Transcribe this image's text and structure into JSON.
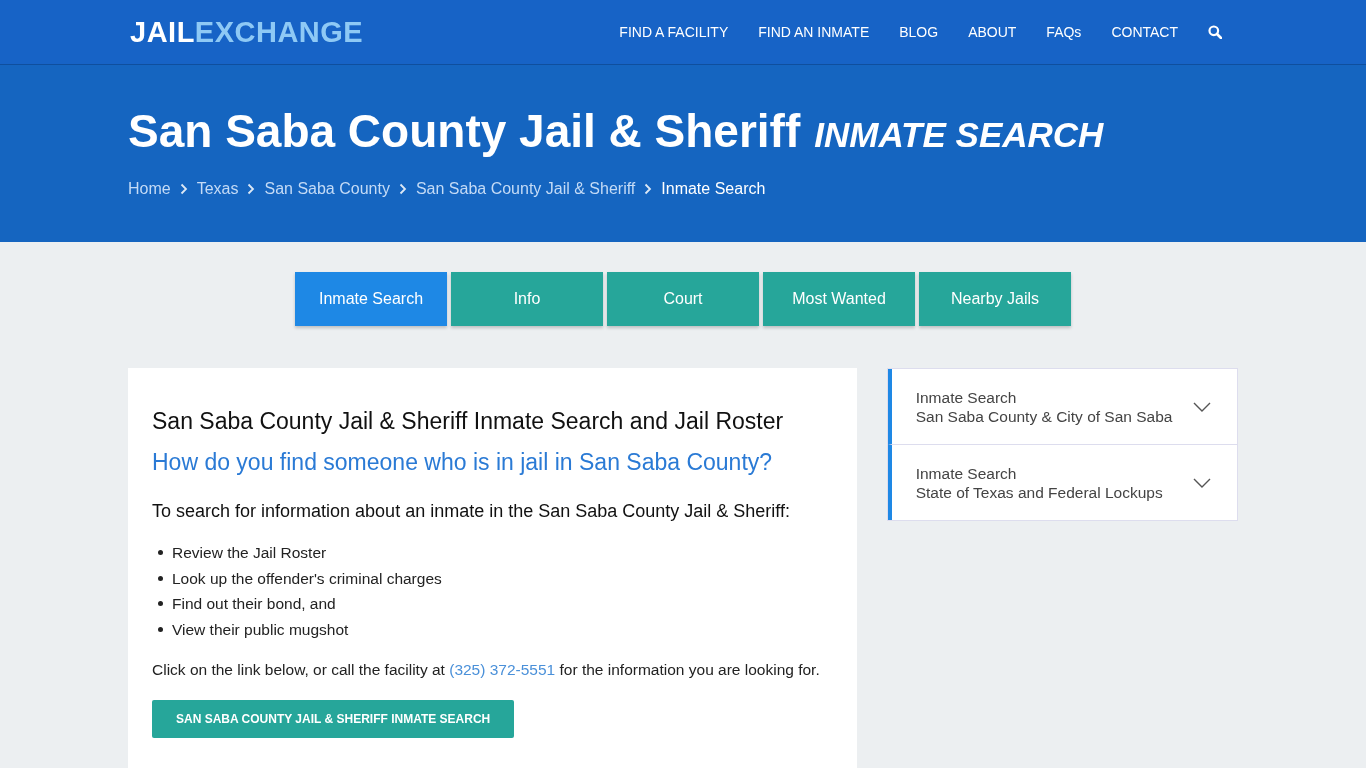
{
  "logo": {
    "part_1": "JAIL",
    "part_2": "EXCHANGE"
  },
  "nav": [
    "FIND A FACILITY",
    "FIND AN INMATE",
    "BLOG",
    "ABOUT",
    "FAQs",
    "CONTACT"
  ],
  "hero": {
    "title": "San Saba County Jail & Sheriff",
    "title_suffix": "INMATE SEARCH",
    "breadcrumbs": [
      {
        "label": "Home",
        "current": false
      },
      {
        "label": "Texas",
        "current": false
      },
      {
        "label": "San Saba County",
        "current": false
      },
      {
        "label": "San Saba County Jail & Sheriff",
        "current": false
      },
      {
        "label": "Inmate Search",
        "current": true
      }
    ]
  },
  "tabs": [
    {
      "label": "Inmate Search",
      "selected": true
    },
    {
      "label": "Info",
      "selected": false
    },
    {
      "label": "Court",
      "selected": false
    },
    {
      "label": "Most Wanted",
      "selected": false
    },
    {
      "label": "Nearby Jails",
      "selected": false
    }
  ],
  "article": {
    "title": "San Saba County Jail & Sheriff Inmate Search and Jail Roster",
    "subtitle": "How do you find someone who is in jail in San Saba County?",
    "intro": "To search for information about an inmate in the San Saba County Jail & Sheriff:",
    "bullets": [
      "Review the Jail Roster",
      "Look up the offender's criminal charges",
      "Find out their bond, and",
      "View their public mugshot"
    ],
    "paragraph_before": "Click on the link below, or call the facility at",
    "phone": "(325) 372-5551",
    "paragraph_after": "for the information you are looking for.",
    "button": "SAN SABA COUNTY JAIL & SHERIFF INMATE SEARCH"
  },
  "sidebar": [
    {
      "title": "Inmate Search",
      "subtitle": "San Saba County & City of San Saba",
      "expanded": false
    },
    {
      "title": "Inmate Search",
      "subtitle": "State of Texas and Federal Lockups",
      "expanded": false
    }
  ]
}
